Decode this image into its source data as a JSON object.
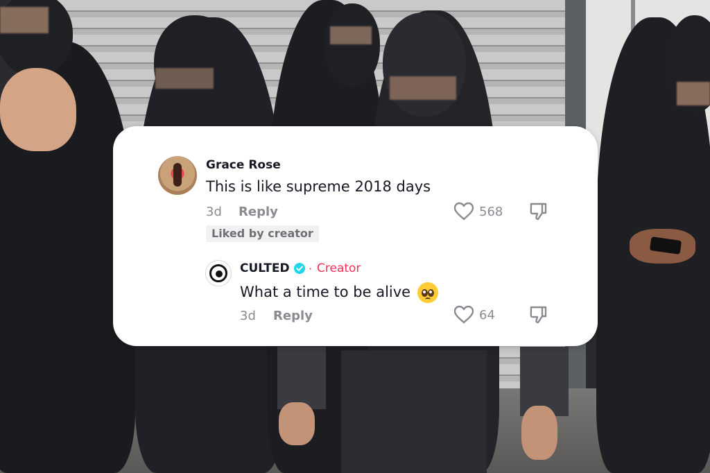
{
  "comments": [
    {
      "username": "Grace Rose",
      "text": "This is like supreme 2018 days",
      "time": "3d",
      "reply_label": "Reply",
      "likes": "568",
      "badge": "Liked by creator"
    },
    {
      "username": "CULTED",
      "verified": true,
      "separator": "·",
      "role": "Creator",
      "text": "What a time to be alive",
      "emoji": "pleading-face",
      "time": "3d",
      "reply_label": "Reply",
      "likes": "64"
    }
  ],
  "colors": {
    "accent": "#fe2c55",
    "verified": "#20d5ec",
    "muted_text": "#8a8b91",
    "card_bg": "#ffffff"
  },
  "icons": [
    "heart-icon",
    "dislike-icon",
    "verified-icon"
  ]
}
